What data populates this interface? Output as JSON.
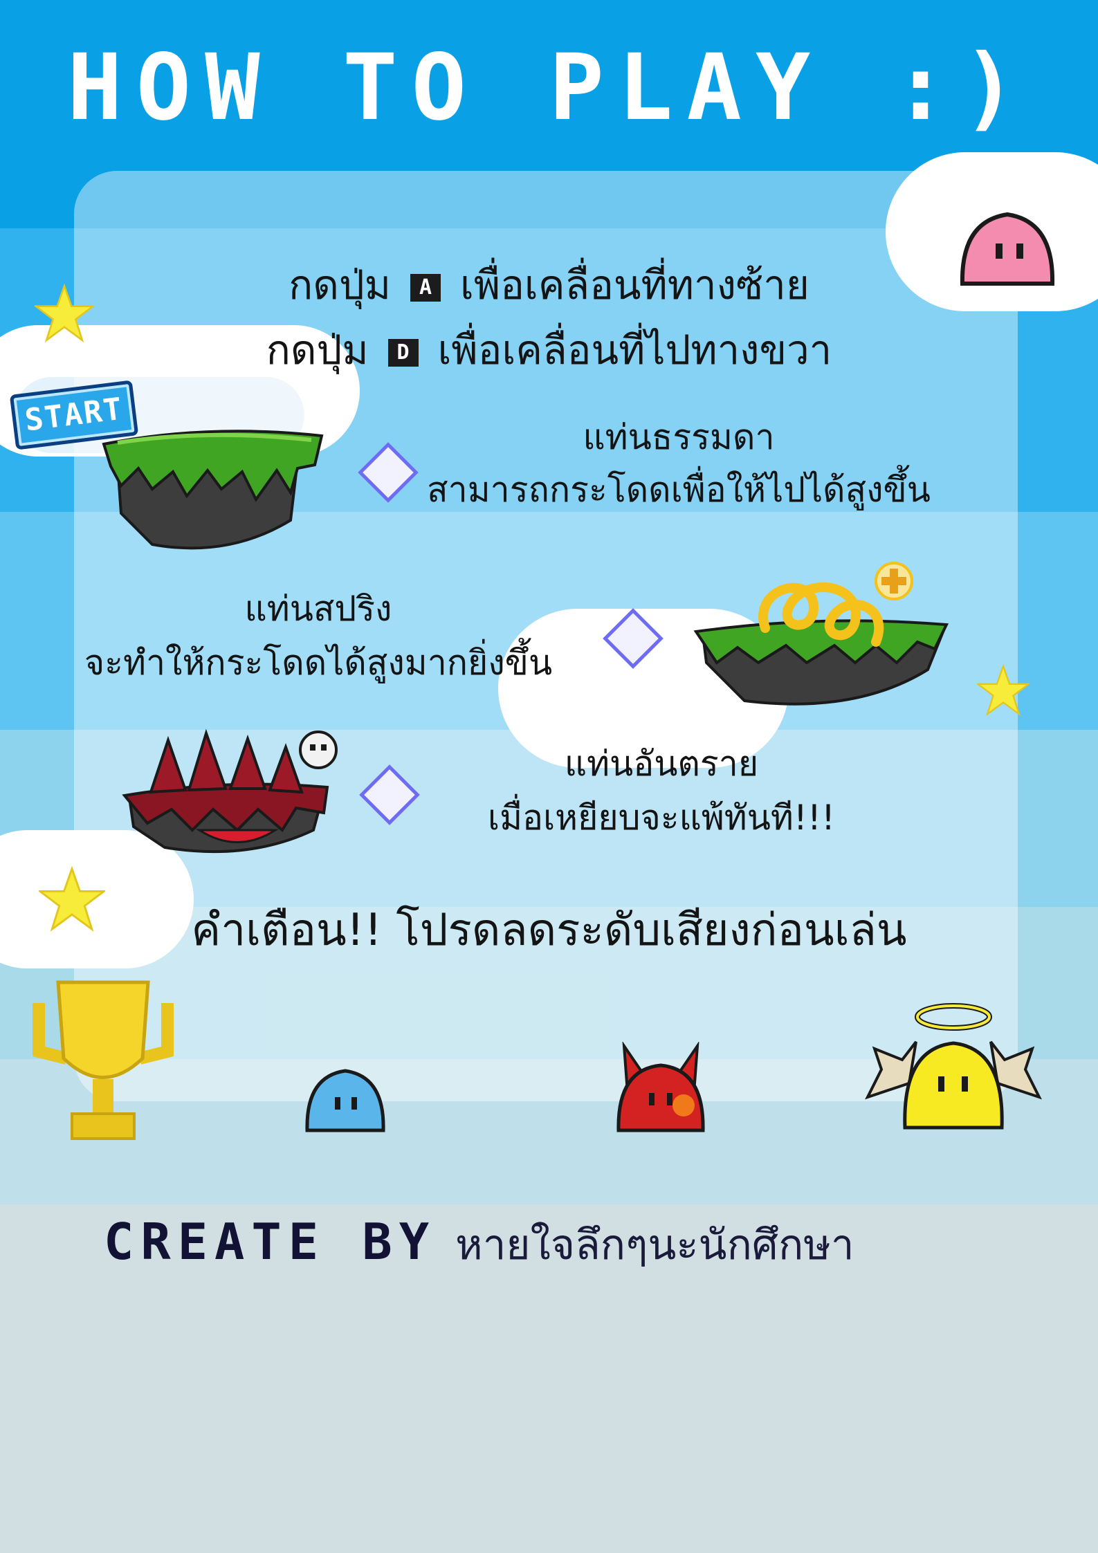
{
  "title": "HOW TO PLAY :)",
  "controls": {
    "left": {
      "prefix": "กดปุ่ม",
      "key": "A",
      "action": "เพื่อเคลื่อนที่ทางซ้าย"
    },
    "right": {
      "prefix": "กดปุ่ม",
      "key": "D",
      "action": "เพื่อเคลื่อนที่ไปทางขวา"
    }
  },
  "start_badge": "START",
  "platforms": [
    {
      "name": "แท่นธรรมดา",
      "description": "สามารถกระโดดเพื่อให้ไปได้สูงขึ้น"
    },
    {
      "name": "แท่นสปริง",
      "description": "จะทำให้กระโดดได้สูงมากยิ่งขึ้น"
    },
    {
      "name": "แท่นอันตราย",
      "description": "เมื่อเหยียบจะแพ้ทันที!!!"
    }
  ],
  "warning": "คำเตือน!! โปรดลดระดับเสียงก่อนเล่น",
  "credit": {
    "label": "CREATE BY",
    "author": "หายใจลึกๆนะนักศึกษา"
  },
  "colors": {
    "sky_top": "#0aa0e6",
    "panel": "#dcf0fa",
    "ground": "#d2dfe2",
    "accent": "#6d6cf2"
  }
}
